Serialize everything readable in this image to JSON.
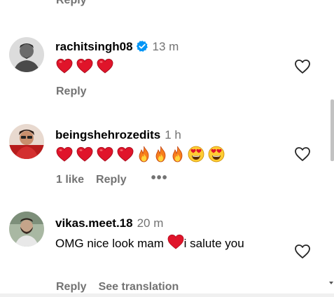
{
  "top": {
    "reply_label": "Reply"
  },
  "comments": [
    {
      "username": "rachitsingh08",
      "verified": true,
      "time": "13 m",
      "emojis": [
        "heart",
        "heart",
        "heart"
      ],
      "actions": {
        "reply": "Reply"
      }
    },
    {
      "username": "beingshehrozedits",
      "time": "1 h",
      "emojis": [
        "heart",
        "heart",
        "heart",
        "heart",
        "fire",
        "fire",
        "fire",
        "heart-eyes",
        "heart-eyes"
      ],
      "actions": {
        "likes": "1 like",
        "reply": "Reply",
        "more": "•••"
      }
    },
    {
      "username": "vikas.meet.18",
      "time": "20 m",
      "text_before": "OMG nice look mam ",
      "text_after": "i salute you",
      "actions": {
        "reply": "Reply",
        "translate": "See translation"
      }
    }
  ],
  "icons": {
    "like": "heart-outline-icon",
    "verified": "verified-badge-icon",
    "more": "more-options-icon"
  },
  "colors": {
    "heart": "#e0142a",
    "verified": "#0095f6",
    "muted": "#737373",
    "fire": "#f77e1c"
  }
}
